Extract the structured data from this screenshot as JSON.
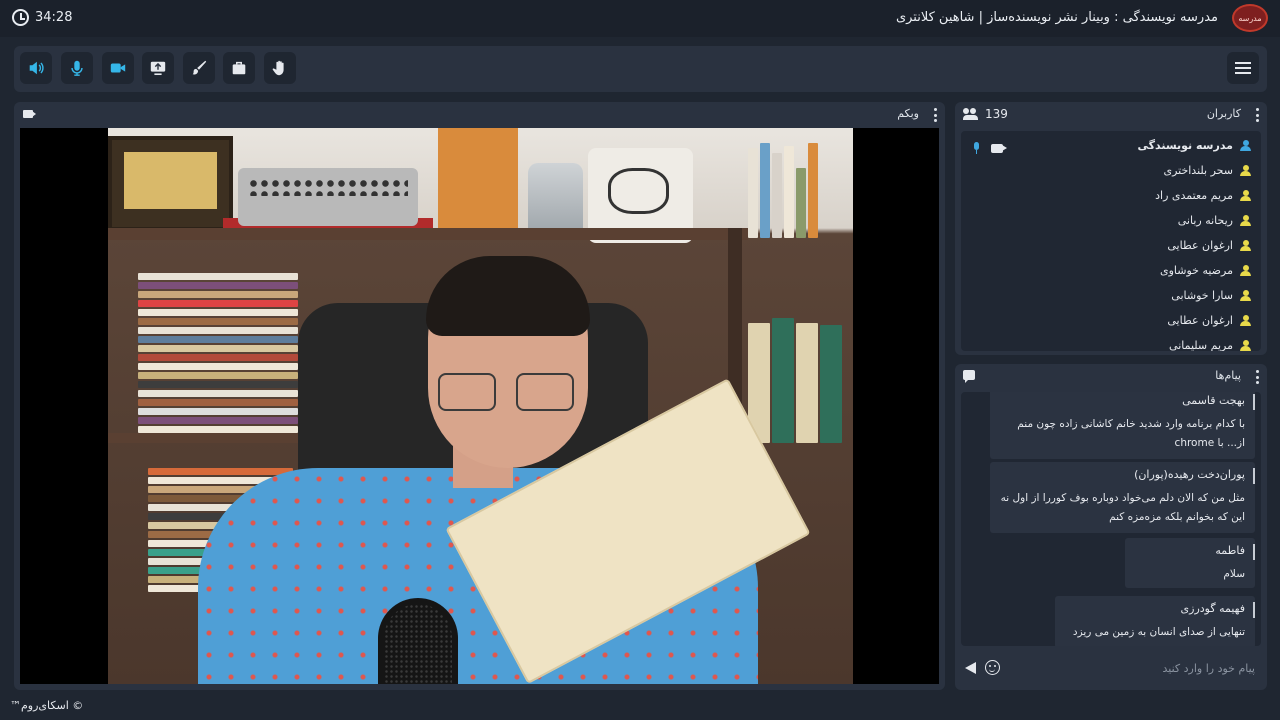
{
  "header": {
    "timer": "34:28",
    "title": "مدرسه نویسندگی : وبینار نشر نویسنده‌ساز | شاهین کلانتری",
    "logo_text": "مدرسه"
  },
  "toolbar": {
    "tools": [
      {
        "name": "speaker-button",
        "icon": "speaker-icon",
        "color": "#35b6e8"
      },
      {
        "name": "microphone-button",
        "icon": "microphone-icon",
        "color": "#35b6e8"
      },
      {
        "name": "camera-button",
        "icon": "camera-icon",
        "color": "#35b6e8"
      },
      {
        "name": "share-screen-button",
        "icon": "share-screen-icon",
        "color": "#e6e9ee"
      },
      {
        "name": "draw-button",
        "icon": "brush-icon",
        "color": "#e6e9ee"
      },
      {
        "name": "files-button",
        "icon": "briefcase-icon",
        "color": "#e6e9ee"
      },
      {
        "name": "raise-hand-button",
        "icon": "hand-icon",
        "color": "#e6e9ee"
      }
    ]
  },
  "webcam": {
    "title": "وبکم"
  },
  "users": {
    "title": "کاربران",
    "count": "139",
    "list": [
      {
        "name": "مدرسه نویسندگی",
        "role": "host",
        "color": "#3fa7e0"
      },
      {
        "name": "سحر بلنداختری",
        "role": "guest",
        "color": "#e8d94a"
      },
      {
        "name": "مریم معتمدی راد",
        "role": "guest",
        "color": "#e8d94a"
      },
      {
        "name": "ریحانه ربانی",
        "role": "guest",
        "color": "#e8d94a"
      },
      {
        "name": "ارغوان عطایی",
        "role": "guest",
        "color": "#e8d94a"
      },
      {
        "name": "مرضیه خوشاوی",
        "role": "guest",
        "color": "#e8d94a"
      },
      {
        "name": "سارا خوشابی",
        "role": "guest",
        "color": "#e8d94a"
      },
      {
        "name": "ارغوان عطایی",
        "role": "guest",
        "color": "#e8d94a"
      },
      {
        "name": "مریم سلیمانی",
        "role": "guest",
        "color": "#e8d94a"
      }
    ]
  },
  "messages": {
    "title": "پیام‌ها",
    "items": [
      {
        "sender": "بهجت قاسمی",
        "text": "با کدام برنامه وارد شدید خانم کاشانی زاده  چون منم از... با chrome"
      },
      {
        "sender": "پوران‌دخت رهیده(پوران)",
        "text": "مثل من که الان دلم می‌خواد دوباره بوف کوررا از اول نه این که بخوانم بلکه مزه‌مزه کنم"
      },
      {
        "sender": "فاطمه",
        "text": "سلام"
      },
      {
        "sender": "فهیمه گودرزی",
        "text": "تنهایی از صدای انسان به زمین می ریزد"
      }
    ],
    "input_placeholder": "پیام خود را وارد کنید"
  },
  "footer": {
    "brand": "© اسکای‌روم™"
  }
}
